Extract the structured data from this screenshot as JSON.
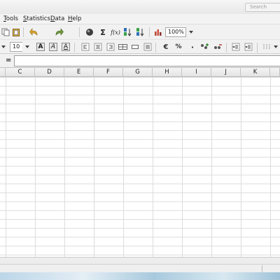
{
  "window": {
    "search_placeholder": "Search"
  },
  "menu": [
    "Tools",
    "Statistics",
    "Data",
    "Help"
  ],
  "toolbar": {
    "zoom": "100%",
    "function_wizard": "f(x)"
  },
  "format_bar": {
    "font_size": "10",
    "bold": "A",
    "italic": "A",
    "underline": "A",
    "currency": "€",
    "percent": "%",
    "thousands": "·"
  },
  "formula_bar": {
    "equals": "=",
    "value": ""
  },
  "grid": {
    "columns": [
      "C",
      "D",
      "E",
      "F",
      "G",
      "H",
      "I",
      "J",
      "K"
    ]
  },
  "colors": {
    "undo": "#d9a62b",
    "redo": "#6f9a3c",
    "sum": "#333333",
    "chart": "#b84a3a",
    "navigator": "#3d3d3d"
  }
}
